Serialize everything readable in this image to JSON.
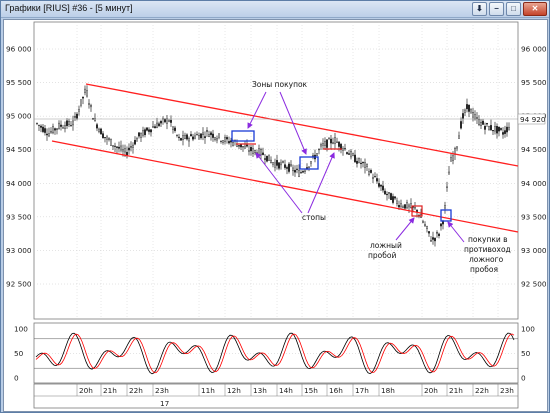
{
  "window": {
    "title": "Графики [RIUS] #36 - [5 минут]",
    "buttons": {
      "download": "⬇",
      "minimize": "−",
      "maximize": "□",
      "close": "✕"
    }
  },
  "chart": {
    "price_ticks": [
      "96 000",
      "95 500",
      "95 000",
      "94 500",
      "94 000",
      "93 500",
      "93 000",
      "92 500"
    ],
    "price_values": [
      96000,
      95500,
      95000,
      94500,
      94000,
      93500,
      93000,
      92500
    ],
    "last_price_label": "94 920",
    "last_price": 94920,
    "osc_ticks": [
      "100",
      "50",
      "0"
    ],
    "osc_values": [
      100,
      50,
      0
    ],
    "time_ticks": [
      "20h",
      "21h",
      "22h",
      "23h",
      "11h",
      "12h",
      "13h",
      "14h",
      "15h",
      "16h",
      "17h",
      "18h",
      "20h",
      "21h",
      "22h",
      "23h"
    ],
    "date_label": "17",
    "colors": {
      "channel": "#ff2020",
      "box_blue": "#1a3bd6",
      "box_red": "#e02020",
      "arrow": "#8b2be0",
      "candle": "#000000",
      "osc_black": "#000000",
      "osc_red": "#ff0000"
    },
    "annotations": {
      "buy_zones": "Зоны покупок",
      "stops": "стопы",
      "false_breakout_1": "ложный",
      "false_breakout_2": "пробой",
      "buy_counter_1": "покупки в",
      "buy_counter_2": "противоход",
      "buy_counter_3": "ложного",
      "buy_counter_4": "пробоя"
    }
  }
}
